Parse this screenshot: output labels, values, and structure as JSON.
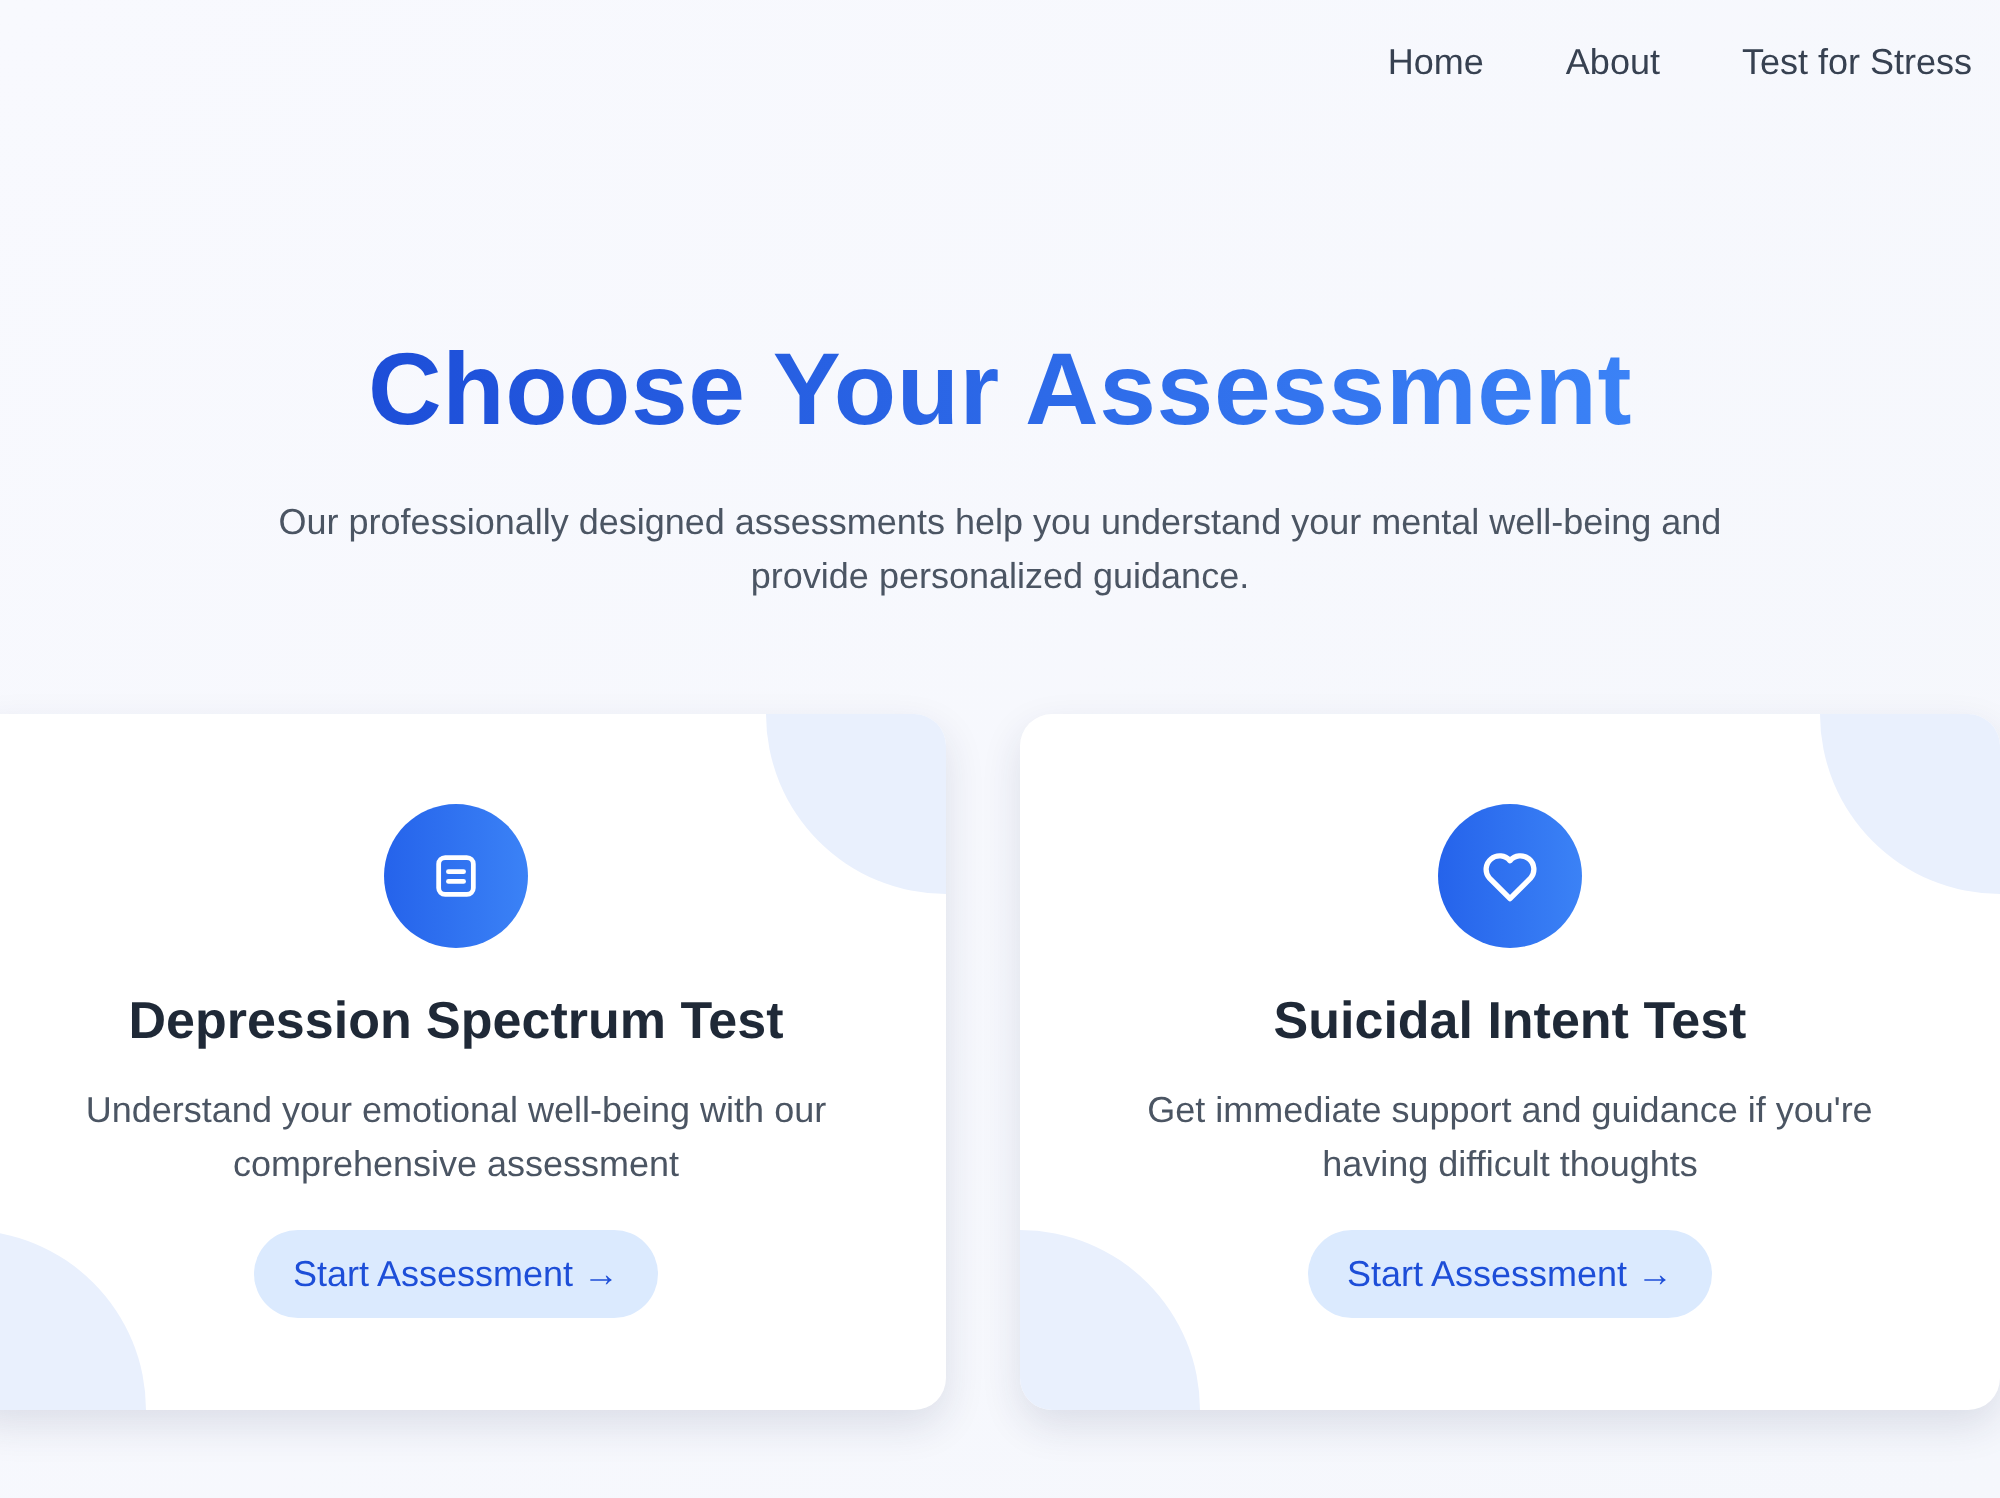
{
  "nav_links": [
    "Home",
    "About",
    "Test for Stress"
  ],
  "hero": {
    "title": "Choose Your Assessment",
    "subtitle": "Our professionally designed assessments help you understand your mental well-being and provide personalized guidance."
  },
  "cards": [
    {
      "kind": "document",
      "title": "Depression Spectrum Test",
      "description": "Understand your emotional well-being with our comprehensive assessment",
      "button": "Start Assessment →"
    },
    {
      "kind": "heart",
      "title": "Suicidal Intent Test",
      "description": "Get immediate support and guidance if you're having difficult thoughts",
      "button": "Start Assessment →"
    }
  ]
}
